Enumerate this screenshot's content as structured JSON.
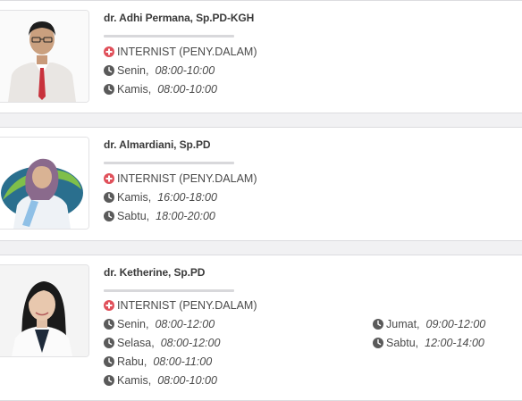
{
  "doctors": [
    {
      "name": "dr. Adhi Permana, Sp.PD-KGH",
      "specialty": "INTERNIST (PENY.DALAM)",
      "schedule": [
        {
          "day": "Senin,",
          "time": "08:00-10:00"
        },
        {
          "day": "Kamis,",
          "time": "08:00-10:00"
        }
      ]
    },
    {
      "name": "dr. Almardiani, Sp.PD",
      "specialty": "INTERNIST (PENY.DALAM)",
      "schedule": [
        {
          "day": "Kamis,",
          "time": "16:00-18:00"
        },
        {
          "day": "Sabtu,",
          "time": "18:00-20:00"
        }
      ]
    },
    {
      "name": "dr. Ketherine, Sp.PD",
      "specialty": "INTERNIST (PENY.DALAM)",
      "schedule": [
        {
          "day": "Senin,",
          "time": "08:00-12:00"
        },
        {
          "day": "Selasa,",
          "time": "08:00-12:00"
        },
        {
          "day": "Rabu,",
          "time": "08:00-11:00"
        },
        {
          "day": "Kamis,",
          "time": "08:00-10:00"
        },
        {
          "day": "Jumat,",
          "time": "09:00-12:00"
        },
        {
          "day": "Sabtu,",
          "time": "12:00-14:00"
        }
      ]
    }
  ],
  "icons": {
    "specialty": "plus-circle-icon",
    "schedule": "clock-icon"
  },
  "colors": {
    "plus_icon": "#e0505a",
    "clock_icon": "#5a5a5a"
  }
}
